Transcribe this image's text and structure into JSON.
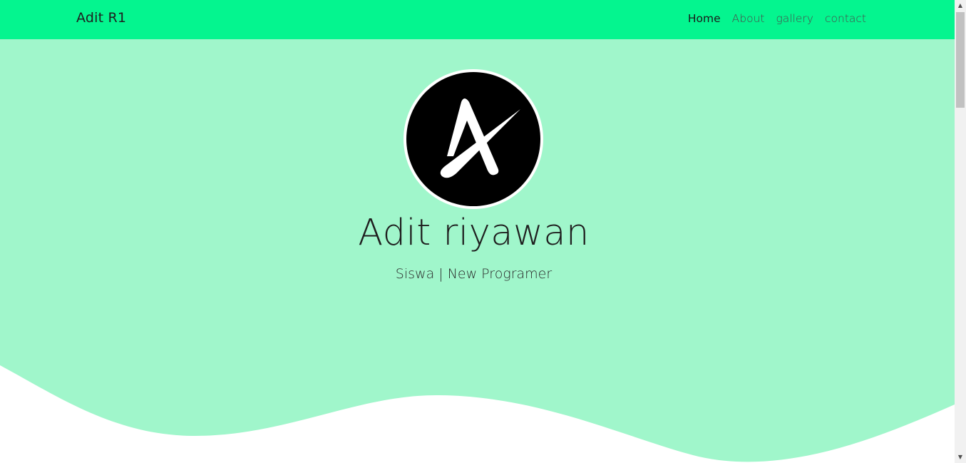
{
  "navbar": {
    "brand": "Adit R1",
    "links": [
      {
        "label": "Home",
        "active": true
      },
      {
        "label": "About",
        "active": false
      },
      {
        "label": "gallery",
        "active": false
      },
      {
        "label": "contact",
        "active": false
      }
    ]
  },
  "hero": {
    "name": "Adit riyawan",
    "subtitle": "Siswa | New Programer",
    "avatar_icon": "letter-a-logo-icon"
  },
  "colors": {
    "navbar_bg": "#04f58f",
    "hero_bg": "#a0f6cb",
    "wave": "#ffffff",
    "avatar_bg": "#000000"
  },
  "scrollbar": {
    "up_icon": "▲",
    "down_icon": "▼"
  }
}
